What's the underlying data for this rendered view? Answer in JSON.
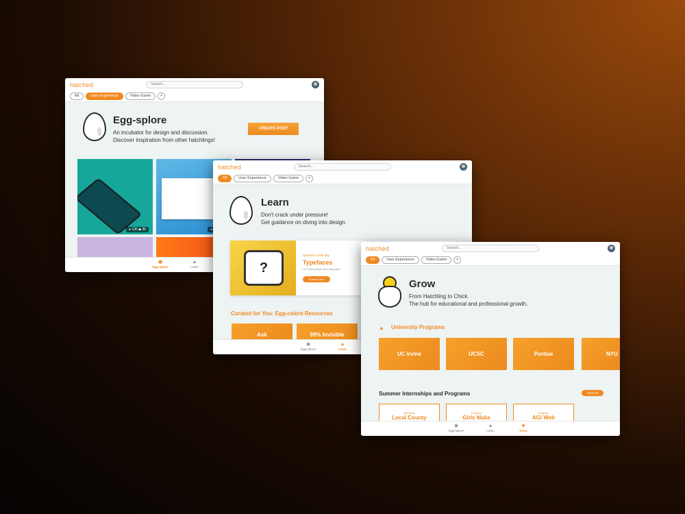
{
  "common": {
    "logo": "hatched",
    "search_placeholder": "Search...",
    "tabs": [
      "All",
      "User Experience",
      "Video Game",
      "+"
    ],
    "nav": {
      "explore": "Egg-splore",
      "learn": "Learn",
      "grow": "Grow"
    }
  },
  "colors": {
    "accent": "#ef8a23",
    "background": "#eef3f3"
  },
  "explore": {
    "title": "Egg-splore",
    "subtitle_1": "An incubator for design and discussion.",
    "subtitle_2": "Discover inspiration from other hatchlings!",
    "create_post": "CREATE POST",
    "card1": {
      "likes": "130",
      "comments": "35"
    },
    "card2": {
      "likes": "130"
    }
  },
  "learn": {
    "title": "Learn",
    "subtitle_1": "Don't crack under pressure!",
    "subtitle_2": "Get guidance on diving into design.",
    "qotd_label": "Question of the day",
    "qotd_title": "Typefaces",
    "qotd_meta": "1127 other people have responded",
    "qotd_button": "Answer Now",
    "curated_title": "Curated for You: Egg-celent Resources",
    "resources": [
      "Ask",
      "99% Invisible"
    ]
  },
  "grow": {
    "title": "Grow",
    "subtitle_1": "From Hatchling to Chick.",
    "subtitle_2": "The hub for educational and professional growth.",
    "university_title": "University Programs",
    "universities": [
      "UC Irvine",
      "UCSC",
      "Purdue",
      "NYU"
    ],
    "internships_title": "Summer Internships and Programs",
    "view_all": "View All",
    "internships": [
      {
        "tag": "Internship",
        "name": "Local County"
      },
      {
        "tag": "Program",
        "name": "Girls Make"
      },
      {
        "tag": "Program",
        "name": "AGI Web"
      }
    ]
  }
}
